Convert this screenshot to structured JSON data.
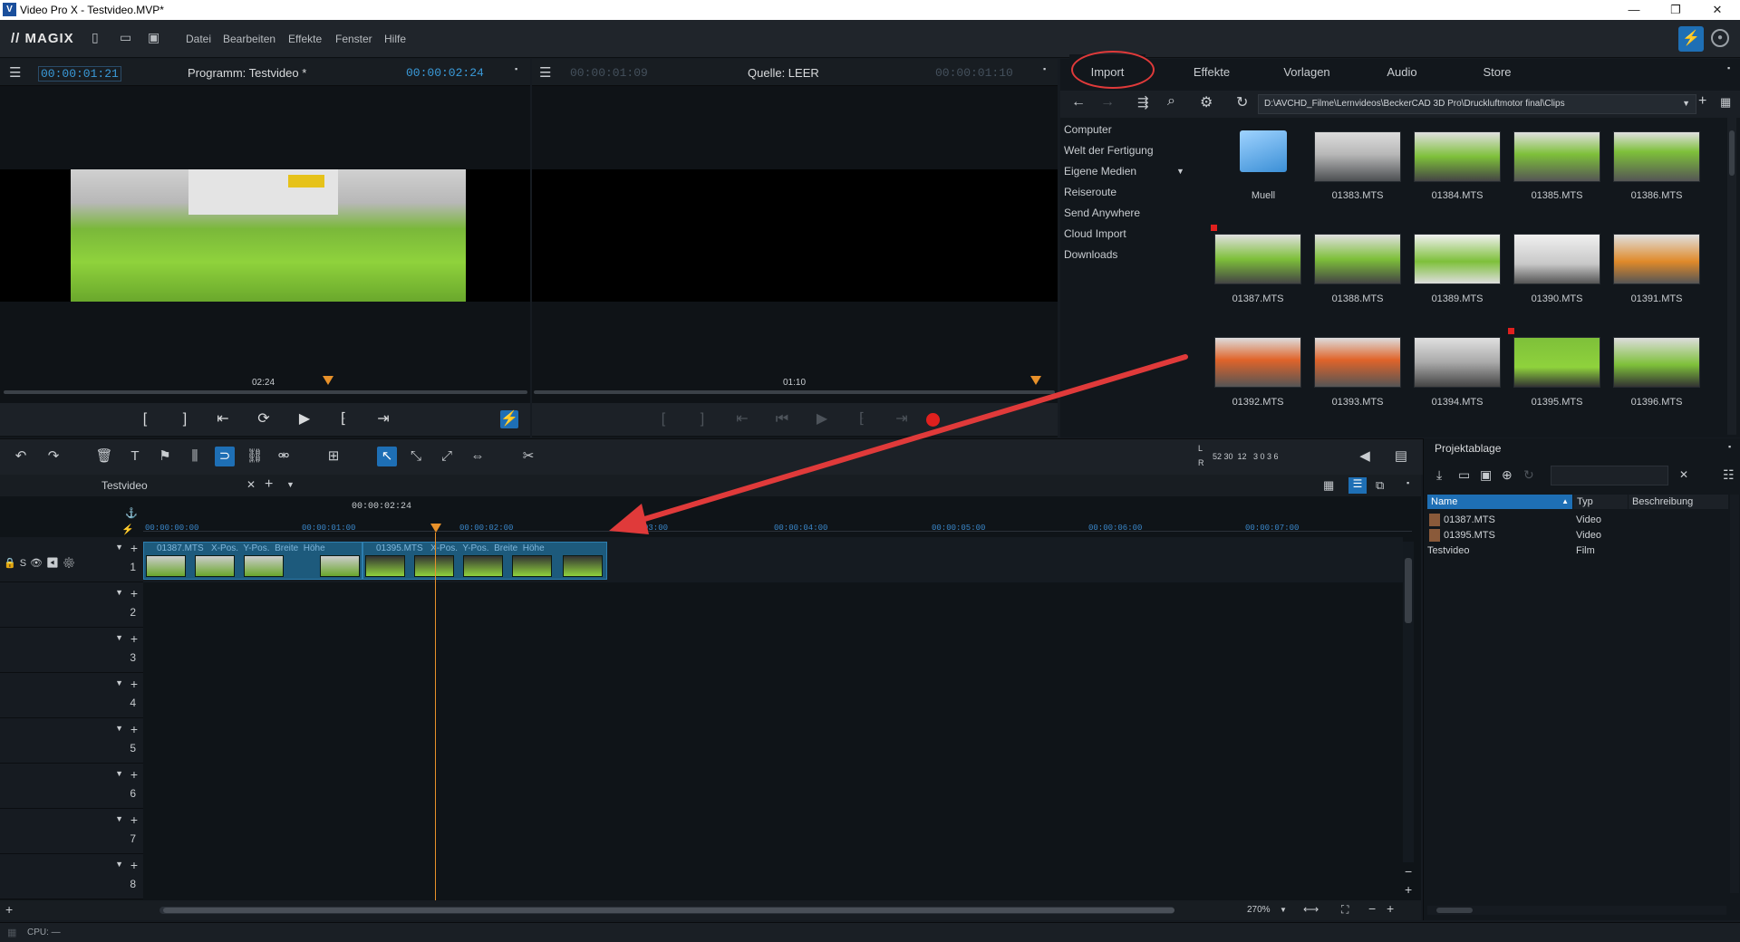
{
  "window": {
    "title": "Video Pro X - Testvideo.MVP*",
    "logo": "V",
    "controls": [
      "—",
      "❐",
      "✕"
    ]
  },
  "menubar": {
    "brand": "// MAGIX",
    "items": [
      "Datei",
      "Bearbeiten",
      "Effekte",
      "Fenster",
      "Hilfe"
    ]
  },
  "program": {
    "tc_left": "00:00:01:21",
    "title": "Programm: Testvideo *",
    "tc_right": "00:00:02:24",
    "scrub_label": "02:24"
  },
  "source": {
    "tc_left": "00:00:01:09",
    "title": "Quelle: LEER",
    "tc_right": "00:00:01:10",
    "scrub_label": "01:10"
  },
  "media": {
    "tabs": [
      "Import",
      "Effekte",
      "Vorlagen",
      "Audio",
      "Store"
    ],
    "active_tab": "Import",
    "path": "D:\\AVCHD_Filme\\Lernvideos\\BeckerCAD 3D Pro\\Druckluftmotor final\\Clips",
    "nav": [
      "Computer",
      "Welt der Fertigung",
      "Eigene Medien",
      "Reiseroute",
      "Send Anywhere",
      "Cloud Import",
      "Downloads"
    ],
    "files": [
      "Muell",
      "01383.MTS",
      "01384.MTS",
      "01385.MTS",
      "01386.MTS",
      "01387.MTS",
      "01388.MTS",
      "01389.MTS",
      "01390.MTS",
      "01391.MTS",
      "01392.MTS",
      "01393.MTS",
      "01394.MTS",
      "01395.MTS",
      "01396.MTS"
    ]
  },
  "timeline": {
    "tab": "Testvideo",
    "playhead_tc": "00:00:02:24",
    "ticks": [
      "00:00:00:00",
      "00:00:01:00",
      "00:00:02:00",
      "03:00",
      "00:00:04:00",
      "00:00:05:00",
      "00:00:06:00",
      "00:00:07:00"
    ],
    "tracks": [
      "1",
      "2",
      "3",
      "4",
      "5",
      "6",
      "7",
      "8"
    ],
    "clips": [
      {
        "label": "01387.MTS   X-Pos.  Y-Pos.  Breite  Höhe"
      },
      {
        "label": "01395.MTS   X-Pos.  Y-Pos.  Breite  Höhe"
      }
    ],
    "zoom": "270%",
    "meter": "52 30  12   3 0 3 6",
    "meter_l": "L",
    "meter_r": "R"
  },
  "project_bin": {
    "title": "Projektablage",
    "columns": [
      "Name",
      "Typ",
      "Beschreibung"
    ],
    "rows": [
      {
        "name": "01387.MTS",
        "type": "Video"
      },
      {
        "name": "01395.MTS",
        "type": "Video"
      },
      {
        "name": "Testvideo",
        "type": "Film"
      }
    ]
  },
  "status": {
    "cpu": "CPU: —"
  },
  "colors": {
    "accent": "#1e6fb5",
    "annotation": "#e03a3a",
    "playhead": "#e8912a",
    "clip": "#1d5a7c"
  }
}
